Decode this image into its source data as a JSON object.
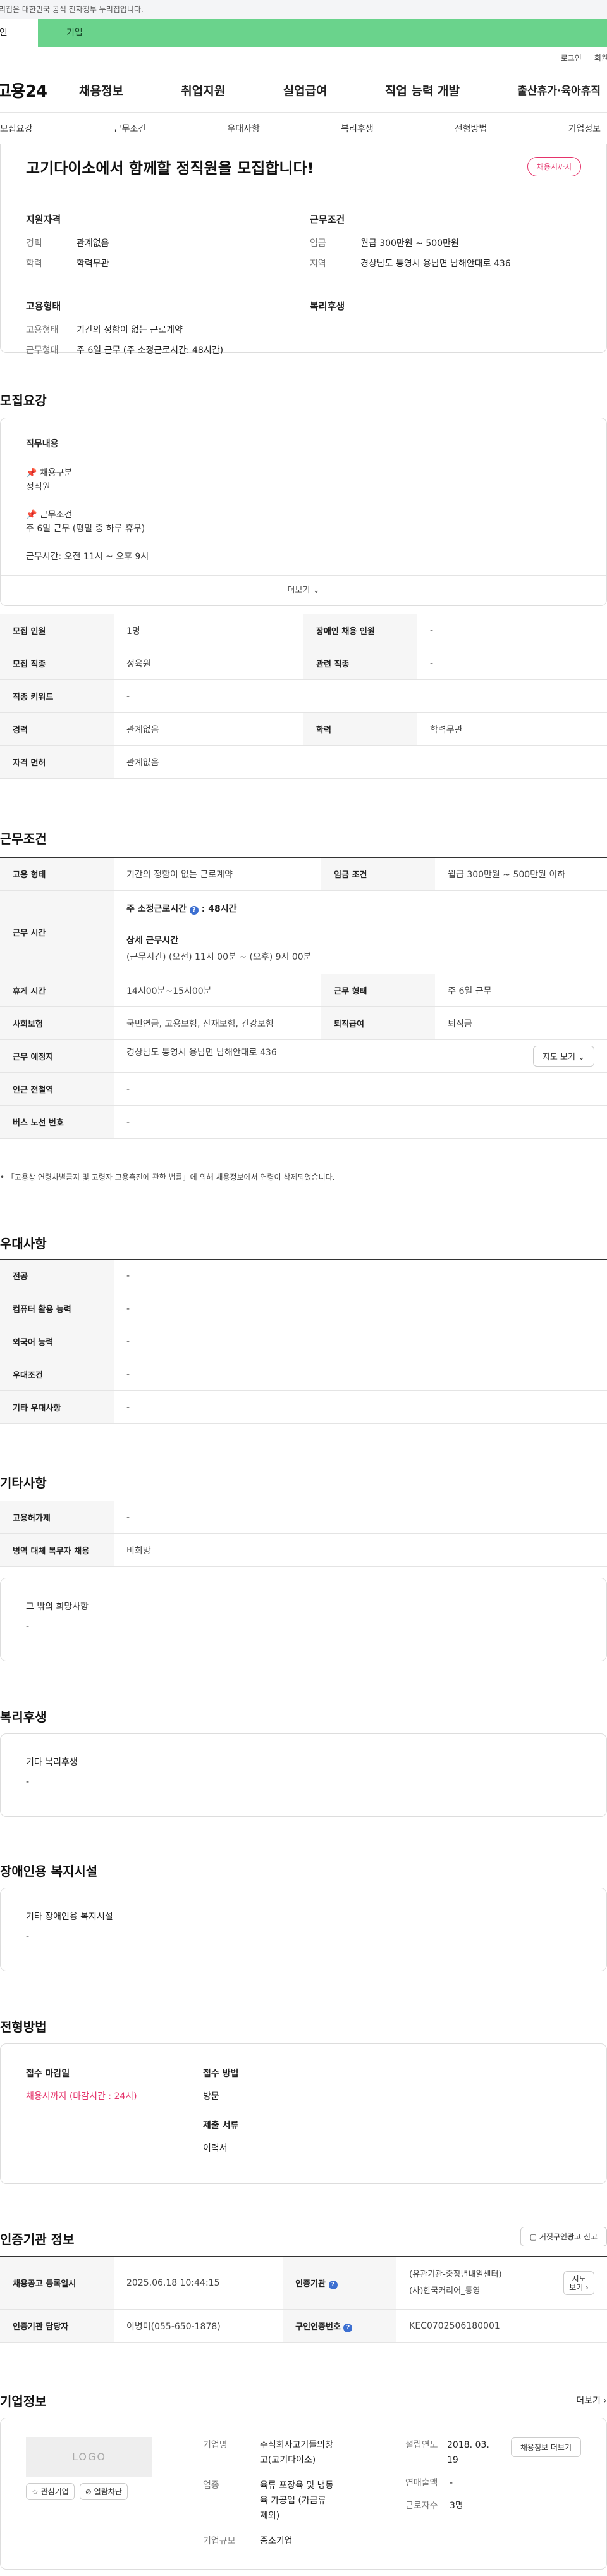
{
  "banner": {
    "text": "이 누리집은 대한민국 공식 전자정부 누리집입니다."
  },
  "top_tabs": {
    "personal": "개인",
    "company": "기업"
  },
  "util": {
    "login": "로그인",
    "signup": "회원가입"
  },
  "gnb": {
    "logo": "고용24",
    "menu": [
      "채용정보",
      "취업지원",
      "실업급여",
      "직업 능력 개발",
      "출산휴가·육아휴직"
    ]
  },
  "subnav": [
    "모집요강",
    "근무조건",
    "우대사항",
    "복리후생",
    "전형방법",
    "기업정보"
  ],
  "hero": {
    "title": "고기다이소에서 함께할 정직원을 모집합니다!",
    "badge": "채용시까지",
    "qualification": {
      "title": "지원자격",
      "rows": [
        {
          "k": "경력",
          "v": "관계없음"
        },
        {
          "k": "학력",
          "v": "학력무관"
        }
      ]
    },
    "work": {
      "title": "근무조건",
      "rows": [
        {
          "k": "임금",
          "v": "월급 300만원 ~ 500만원"
        },
        {
          "k": "지역",
          "v": "경상남도 통영시 용남면 남해안대로 436"
        }
      ]
    },
    "employment": {
      "title": "고용형태",
      "rows": [
        {
          "k": "고용형태",
          "v": "기간의 정함이 없는 근로계약"
        },
        {
          "k": "근무형태",
          "v": "주 6일 근무 (주 소정근로시간: 48시간)"
        }
      ]
    },
    "welfare": {
      "title": "복리후생"
    }
  },
  "recruit": {
    "title": "모집요강",
    "duty_title": "직무내용",
    "duty_lines": [
      "📌 채용구분",
      "정직원",
      "",
      "📌 근무조건",
      "주 6일 근무 (평일 중 하루 휴무)",
      "",
      "근무시간: 오전 11시 ~ 오후 9시"
    ],
    "more": "더보기",
    "table": [
      [
        {
          "k": "모집 인원",
          "v": "1명"
        },
        {
          "k": "장애인 채용 인원",
          "v": "-"
        }
      ],
      [
        {
          "k": "모집 직종",
          "v": "정육원"
        },
        {
          "k": "관련 직종",
          "v": "-"
        }
      ],
      [
        {
          "k": "직종 키워드",
          "v": "-"
        }
      ],
      [
        {
          "k": "경력",
          "v": "관계없음"
        },
        {
          "k": "학력",
          "v": "학력무관"
        }
      ],
      [
        {
          "k": "자격 면허",
          "v": "관계없음"
        }
      ]
    ]
  },
  "conditions": {
    "title": "근무조건",
    "employ_type": {
      "k": "고용 형태",
      "v": "기간의 정함이 없는 근로계약"
    },
    "wage": {
      "k": "임금 조건",
      "v": "월급 300만원 ~ 500만원 이하"
    },
    "hours_label": "근무 시간",
    "hours_prefix": "주 소정근로시간",
    "hours_value": ": 48시간",
    "detail_title": "상세 근무시간",
    "detail_value": "(근무시간) (오전) 11시 00분 ~ (오후) 9시 00분",
    "break": {
      "k": "휴게 시간",
      "v": "14시00분~15시00분"
    },
    "shift": {
      "k": "근무 형태",
      "v": "주 6일 근무"
    },
    "insurance": {
      "k": "사회보험",
      "v": "국민연금, 고용보험, 산재보험, 건강보험"
    },
    "retire": {
      "k": "퇴직급여",
      "v": "퇴직금"
    },
    "place": {
      "k": "근무 예정지",
      "v": "경상남도 통영시 용남면 남해안대로 436"
    },
    "map_btn": "지도 보기",
    "station": {
      "k": "인근 전철역",
      "v": "-"
    },
    "bus": {
      "k": "버스 노선 번호",
      "v": "-"
    },
    "notice": "「고용상 연령차별금지 및 고령자 고용촉진에 관한 법률」에 의해 채용정보에서 연령이 삭제되었습니다."
  },
  "preference": {
    "title": "우대사항",
    "rows": [
      {
        "k": "전공",
        "v": "-"
      },
      {
        "k": "컴퓨터 활용 능력",
        "v": "-"
      },
      {
        "k": "외국어 능력",
        "v": "-"
      },
      {
        "k": "우대조건",
        "v": "-"
      },
      {
        "k": "기타 우대사항",
        "v": "-"
      }
    ]
  },
  "etc": {
    "title": "기타사항",
    "rows": [
      {
        "k": "고용허가제",
        "v": "-"
      },
      {
        "k": "병역 대체 복무자 채용",
        "v": "비희망"
      }
    ],
    "box_title": "그 밖의 희망사항",
    "box_value": "-"
  },
  "welfare": {
    "title": "복리후생",
    "box_title": "기타 복리후생",
    "box_value": "-"
  },
  "disability": {
    "title": "장애인용 복지시설",
    "box_title": "기타 장애인용 복지시설",
    "box_value": "-"
  },
  "selection": {
    "title": "전형방법",
    "deadline_title": "접수 마감일",
    "deadline_value": "채용시까지 (마감시간 : 24시)",
    "method_title": "접수 방법",
    "method_value": "방문",
    "docs_title": "제출 서류",
    "docs_value": "이력서"
  },
  "cert": {
    "title": "인증기관 정보",
    "report_btn": "거짓구인광고 신고",
    "date": {
      "k": "채용공고 등록일시",
      "v": "2025.06.18 10:44:15"
    },
    "org": {
      "k": "인증기관",
      "v1": "(유관기관-중장년내일센터)",
      "v2": "(사)한국커리어_통영"
    },
    "map_btn_l1": "지도",
    "map_btn_l2": "보기",
    "manager": {
      "k": "인증기관 담당자",
      "v": "이병미(055-650-1878)"
    },
    "id": {
      "k": "구인인증번호",
      "v": "KEC0702506180001"
    }
  },
  "company": {
    "title": "기업정보",
    "more": "더보기",
    "logo": "LOGO",
    "fav_btn": "관심기업",
    "block_btn": "열람차단",
    "name_k": "기업명",
    "name_v": "주식회사고기들의창고(고기다이소)",
    "industry_k": "업종",
    "industry_v": "육류 포장육 및 냉동육 가공업 (가금류 제외)",
    "scale_k": "기업규모",
    "scale_v": "중소기업",
    "founded_k": "설립연도",
    "founded_v": "2018. 03. 19",
    "sales_k": "연매출액",
    "sales_v": "-",
    "staff_k": "근로자수",
    "staff_v": "3명",
    "jobs_btn": "채용정보 더보기"
  }
}
